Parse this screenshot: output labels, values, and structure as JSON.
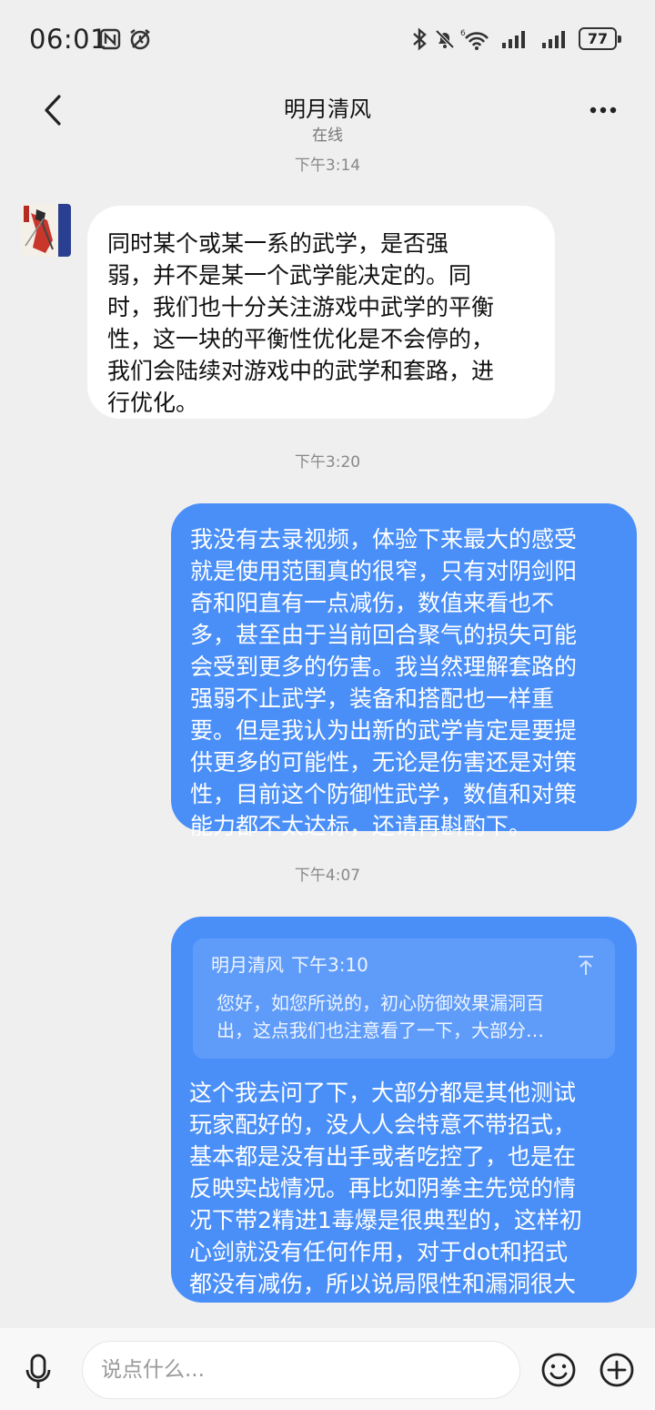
{
  "status_bar": {
    "time": "06:01",
    "battery": "77",
    "icons": [
      "nfc-icon",
      "alarm-icon",
      "bluetooth-icon",
      "mute-icon",
      "wifi-6-icon",
      "signal-icon",
      "signal-icon-2"
    ]
  },
  "header": {
    "title": "明月清风",
    "subtitle": "在线"
  },
  "messages": [
    {
      "timestamp": "下午3:14",
      "side": "left",
      "text": " 同时某个或某一系的武学，是否强\n弱，并不是某一个武学能决定的。同\n时，我们也十分关注游戏中武学的平衡\n性，这一块的平衡性优化是不会停的，\n我们会陆续对游戏中的武学和套路，进\n行优化。"
    },
    {
      "timestamp": "下午3:20",
      "side": "right",
      "text": "我没有去录视频，体验下来最大的感受\n就是使用范围真的很窄，只有对阴剑阳\n奇和阳直有一点减伤，数值来看也不\n多，甚至由于当前回合聚气的损失可能\n会受到更多的伤害。我当然理解套路的\n强弱不止武学，装备和搭配也一样重\n要。但是我认为出新的武学肯定是要提\n供更多的可能性，无论是伤害还是对策\n性，目前这个防御性武学，数值和对策\n能力都不太达标，还请再斟酌下。"
    },
    {
      "timestamp": "下午4:07",
      "side": "right",
      "quote": {
        "author": "明月清风",
        "time": "下午3:10",
        "text": "您好，如您所说的，初心防御效果漏洞百\n出，这点我们也注意看了一下，大部分…"
      },
      "text": "这个我去问了下，大部分都是其他测试\n玩家配好的，没人人会特意不带招式，\n基本都是没有出手或者吃控了，也是在\n反映实战情况。再比如阴拳主先觉的情\n况下带2精进1毒爆是很典型的，这样初\n心剑就没有任何作用，对于dot和招式\n都没有减伤，所以说局限性和漏洞很大"
    }
  ],
  "input": {
    "placeholder": "说点什么..."
  },
  "colors": {
    "background": "#efefef",
    "bubble_self": "#4a8ff8",
    "bubble_other": "#ffffff"
  }
}
